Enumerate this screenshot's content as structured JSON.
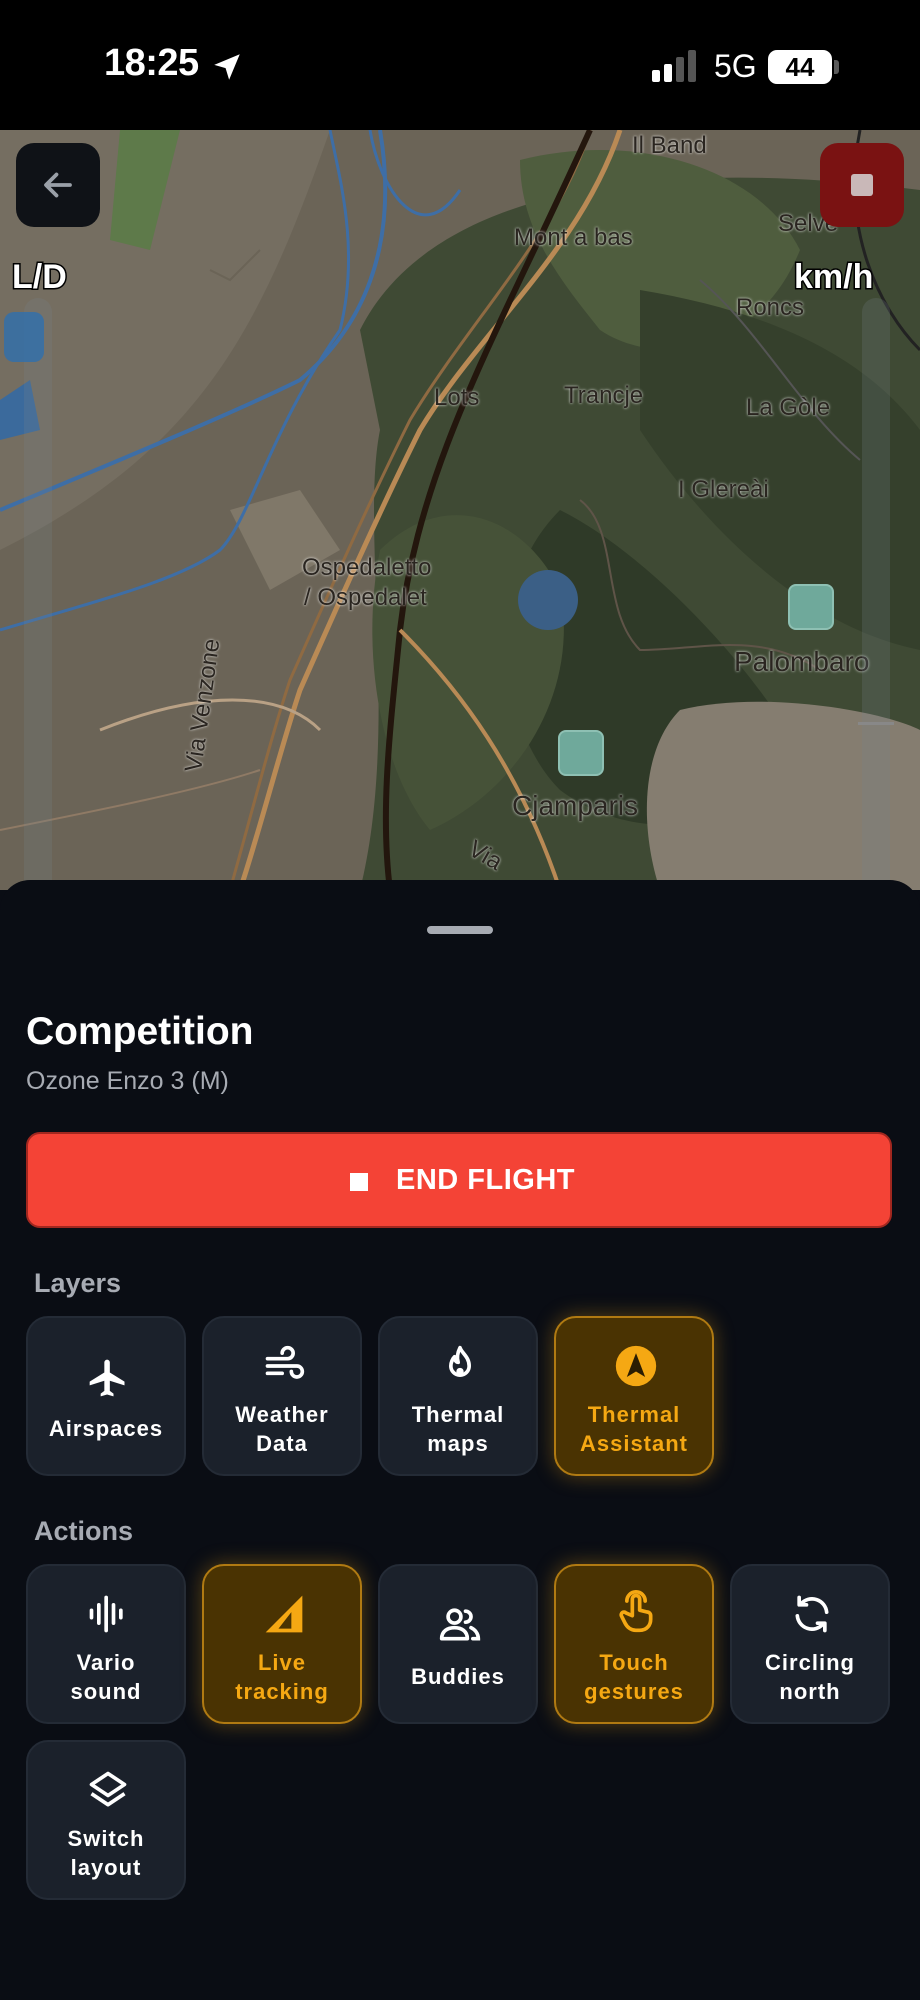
{
  "status_bar": {
    "time": "18:25",
    "network": "5G",
    "battery": "44"
  },
  "map": {
    "places": [
      "Il Band",
      "Mont a bas",
      "Selve",
      "Roncs",
      "Lots",
      "Trancje",
      "La Gòle",
      "I Glereài",
      "Ospedaletto",
      "/ Ospedalet",
      "Palombaro",
      "Cjamparis",
      "Via Venzone",
      "Via"
    ],
    "left_gauge_label": "L/D",
    "right_gauge_label": "km/h"
  },
  "sheet": {
    "title": "Competition",
    "subtitle": "Ozone Enzo 3 (M)",
    "end_button": "END FLIGHT",
    "layers_heading": "Layers",
    "actions_heading": "Actions",
    "layers": [
      {
        "line1": "Airspaces",
        "line2": "",
        "active": false,
        "icon": "plane-icon"
      },
      {
        "line1": "Weather",
        "line2": "Data",
        "active": false,
        "icon": "wind-icon"
      },
      {
        "line1": "Thermal",
        "line2": "maps",
        "active": false,
        "icon": "flame-icon"
      },
      {
        "line1": "Thermal",
        "line2": "Assistant",
        "active": true,
        "icon": "navigation-arrow-icon"
      }
    ],
    "actions": [
      {
        "line1": "Vario",
        "line2": "sound",
        "active": false,
        "icon": "audio-wave-icon"
      },
      {
        "line1": "Live",
        "line2": "tracking",
        "active": true,
        "icon": "signal-triangle-icon"
      },
      {
        "line1": "Buddies",
        "line2": "",
        "active": false,
        "icon": "users-icon"
      },
      {
        "line1": "Touch",
        "line2": "gestures",
        "active": true,
        "icon": "pointer-hand-icon"
      },
      {
        "line1": "Circling",
        "line2": "north",
        "active": false,
        "icon": "rotate-icon"
      },
      {
        "line1": "Switch",
        "line2": "layout",
        "active": false,
        "icon": "layers-icon"
      }
    ]
  },
  "colors": {
    "accent": "#f5a813",
    "end_button": "#f44336",
    "tile": "#1b212b",
    "background": "#0a0d14"
  }
}
